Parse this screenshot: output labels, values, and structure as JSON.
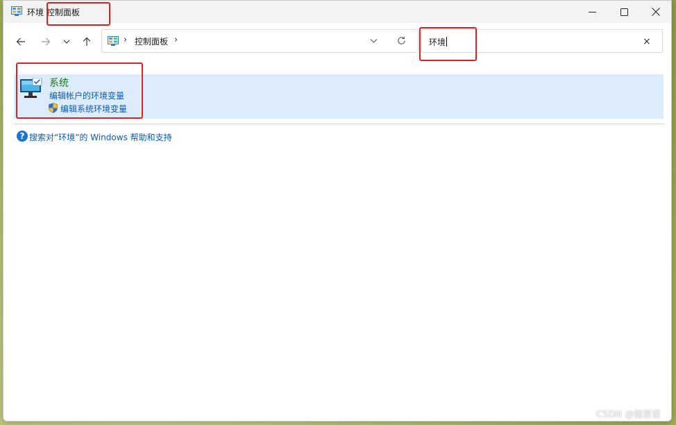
{
  "window": {
    "title": "环境",
    "title_highlight": "控制面板",
    "minimize_icon": "minimize-icon",
    "maximize_icon": "maximize-icon",
    "close_icon": "close-icon"
  },
  "nav": {
    "back_icon": "arrow-left-icon",
    "forward_icon": "arrow-right-icon",
    "recent_icon": "chevron-down-icon",
    "up_icon": "arrow-up-icon"
  },
  "address": {
    "icon": "control-panel-icon",
    "separator": "›",
    "path": "控制面板",
    "trailing_separator": "›",
    "dropdown_icon": "chevron-down-icon",
    "refresh_icon": "refresh-icon"
  },
  "search": {
    "value": "环境",
    "clear_label": "×"
  },
  "result": {
    "icon": "system-monitor-icon",
    "title": "系统",
    "links": [
      {
        "label": "编辑帐户的环境变量"
      },
      {
        "label": "编辑系统环境变量",
        "icon": "uac-shield-icon"
      }
    ]
  },
  "help": {
    "icon_glyph": "?",
    "text": "搜索对“环境”的 Windows 帮助和支持"
  },
  "watermark": "CSDN @懿思哲",
  "colors": {
    "highlight_box": "#e02020",
    "result_bg": "#dcecfb",
    "link": "#0a5bbd",
    "result_title": "#1a7a1a"
  }
}
